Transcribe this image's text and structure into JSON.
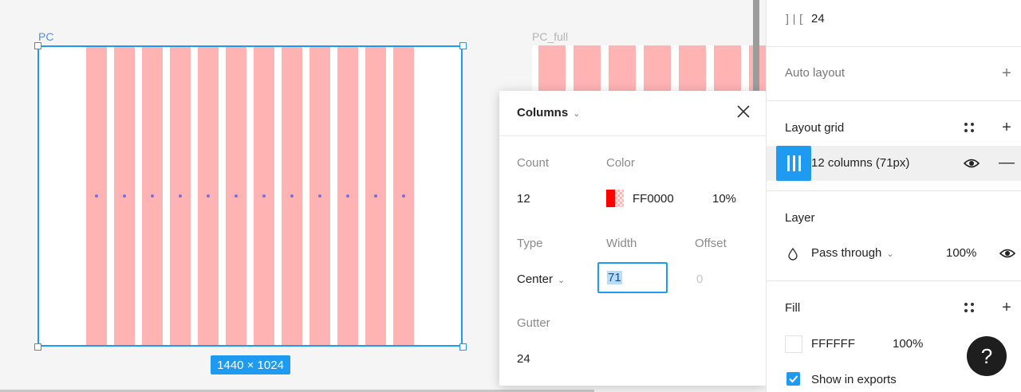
{
  "canvas": {
    "frame_pc": {
      "label": "PC",
      "size": "1440 × 1024",
      "column_count": 12
    },
    "frame_full": {
      "label": "PC_full"
    }
  },
  "popover": {
    "title": "Columns",
    "count_label": "Count",
    "count_value": "12",
    "color_label": "Color",
    "color_hex": "FF0000",
    "color_opacity": "10%",
    "type_label": "Type",
    "type_value": "Center",
    "width_label": "Width",
    "width_value": "71",
    "offset_label": "Offset",
    "offset_value": "0",
    "gutter_label": "Gutter",
    "gutter_value": "24"
  },
  "panel": {
    "spacing_value": "24",
    "auto_layout": "Auto layout",
    "layout_grid": {
      "title": "Layout grid",
      "item": "12 columns (71px)"
    },
    "layer": {
      "title": "Layer",
      "blend": "Pass through",
      "opacity": "100%"
    },
    "fill": {
      "title": "Fill",
      "hex": "FFFFFF",
      "opacity": "100%"
    },
    "show_in_exports": "Show in exports"
  },
  "colors": {
    "accent": "#1e9bf0",
    "grid_column": "#ffb3b3",
    "grid_color": "#ff0000"
  },
  "icons": [
    "close-icon",
    "chevron-down-icon",
    "plus-icon",
    "minus-icon",
    "eye-icon",
    "grid-styles-icon",
    "columns-grid-icon",
    "drop-icon",
    "help-icon",
    "spacing-icon"
  ]
}
